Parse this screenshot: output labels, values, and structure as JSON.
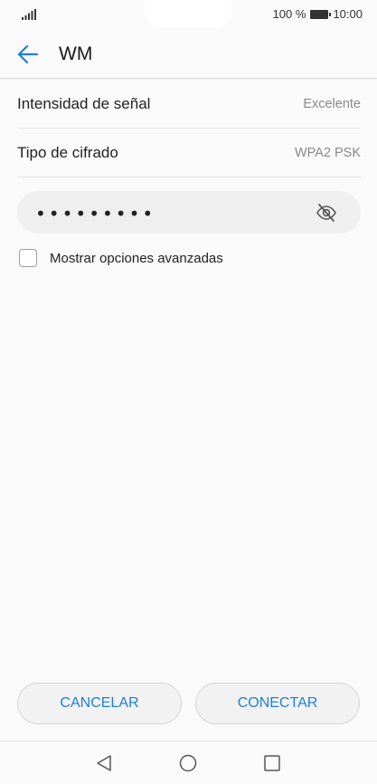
{
  "status_bar": {
    "signal_icon": "signal-icon",
    "battery_percent": "100 %",
    "battery_icon": "battery-icon",
    "time": "10:00"
  },
  "header": {
    "back_icon": "arrow-left-icon",
    "title": "WM"
  },
  "details": [
    {
      "label": "Intensidad de señal",
      "value": "Excelente"
    },
    {
      "label": "Tipo de cifrado",
      "value": "WPA2 PSK"
    }
  ],
  "password": {
    "value": "•••••••••",
    "toggle_icon": "eye-off-icon"
  },
  "advanced_options": {
    "label": "Mostrar opciones avanzadas",
    "checked": false
  },
  "actions": {
    "cancel_label": "CANCELAR",
    "connect_label": "CONECTAR"
  },
  "nav_bar": {
    "back_icon": "triangle-back-icon",
    "home_icon": "circle-home-icon",
    "recent_icon": "square-recent-icon"
  },
  "colors": {
    "accent": "#1e7fd6",
    "background": "#fafafa",
    "field_background": "#efefef",
    "secondary_text": "#8a8a8a"
  }
}
